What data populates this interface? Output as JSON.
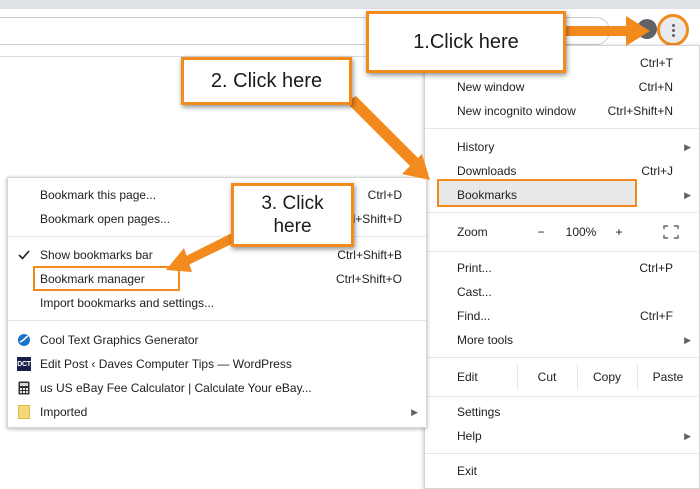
{
  "menu": {
    "items": [
      {
        "label": "",
        "shortcut": "Ctrl+T"
      },
      {
        "label": "New window",
        "shortcut": "Ctrl+N"
      },
      {
        "label": "New incognito window",
        "shortcut": "Ctrl+Shift+N"
      },
      {
        "label": "History",
        "shortcut": ""
      },
      {
        "label": "Downloads",
        "shortcut": "Ctrl+J"
      },
      {
        "label": "Bookmarks",
        "shortcut": ""
      },
      {
        "label": "Print...",
        "shortcut": "Ctrl+P"
      },
      {
        "label": "Cast...",
        "shortcut": ""
      },
      {
        "label": "Find...",
        "shortcut": "Ctrl+F"
      },
      {
        "label": "More tools",
        "shortcut": ""
      },
      {
        "label": "Settings",
        "shortcut": ""
      },
      {
        "label": "Help",
        "shortcut": ""
      },
      {
        "label": "Exit",
        "shortcut": ""
      }
    ],
    "zoom": {
      "label": "Zoom",
      "minus": "−",
      "value": "100%",
      "plus": "+"
    },
    "edit": {
      "label": "Edit",
      "cut": "Cut",
      "copy": "Copy",
      "paste": "Paste"
    }
  },
  "bookmarks_submenu": {
    "items": [
      {
        "label": "Bookmark this page...",
        "shortcut": "Ctrl+D"
      },
      {
        "label": "Bookmark open pages...",
        "shortcut": "Ctrl+Shift+D"
      },
      {
        "label": "Show bookmarks bar",
        "shortcut": "Ctrl+Shift+B",
        "checked": true
      },
      {
        "label": "Bookmark manager",
        "shortcut": "Ctrl+Shift+O"
      },
      {
        "label": "Import bookmarks and settings...",
        "shortcut": ""
      },
      {
        "label": "Cool Text Graphics Generator",
        "icon": "cooltext-favicon-icon"
      },
      {
        "label": "Edit Post ‹ Daves Computer Tips — WordPress",
        "icon": "dct-favicon-icon"
      },
      {
        "label": "us US eBay Fee Calculator | Calculate Your eBay...",
        "icon": "calculator-favicon-icon"
      },
      {
        "label": "Imported",
        "icon": "folder-icon"
      }
    ],
    "dct_badge": "DCT"
  },
  "callouts": {
    "step1": "1.Click here",
    "step2": "2. Click here",
    "step3_line1": "3. Click",
    "step3_line2": "here"
  },
  "colors": {
    "accent": "#f28a1e",
    "highlight": "#e8e8e8"
  }
}
